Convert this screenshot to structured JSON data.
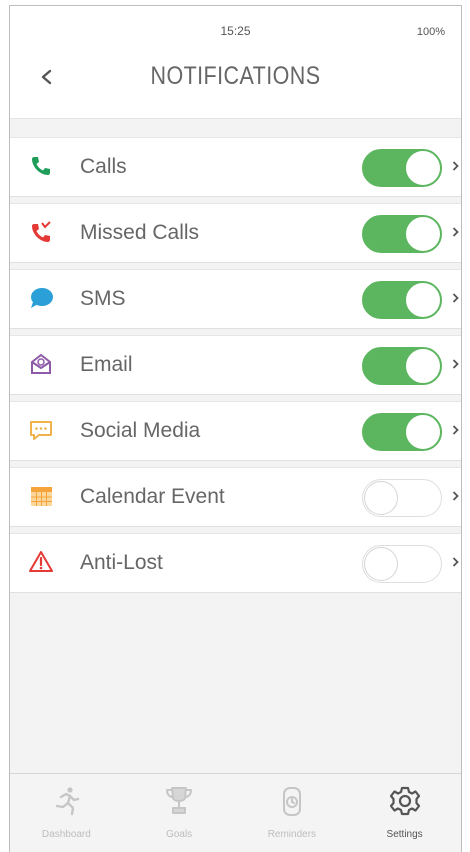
{
  "status": {
    "time": "15:25",
    "battery": "100%"
  },
  "header": {
    "title": "NOTIFICATIONS",
    "back_icon": "chevron-left-icon"
  },
  "notifications": [
    {
      "label": "Calls",
      "icon": "phone-icon",
      "color": "#1f9e5a",
      "enabled": true
    },
    {
      "label": "Missed Calls",
      "icon": "missed-call-icon",
      "color": "#e53935",
      "enabled": true
    },
    {
      "label": "SMS",
      "icon": "chat-bubble-icon",
      "color": "#2a9fd8",
      "enabled": true
    },
    {
      "label": "Email",
      "icon": "envelope-icon",
      "color": "#8e5ba8",
      "enabled": true
    },
    {
      "label": "Social Media",
      "icon": "speech-icon",
      "color": "#f0b24a",
      "enabled": true
    },
    {
      "label": "Calendar Event",
      "icon": "calendar-icon",
      "color": "#f4a43a",
      "enabled": false
    },
    {
      "label": "Anti-Lost",
      "icon": "warning-icon",
      "color": "#e53935",
      "enabled": false
    }
  ],
  "toggle_on_color": "#5cb65f",
  "tabs": [
    {
      "label": "Dashboard",
      "icon": "running-man-icon",
      "active": false
    },
    {
      "label": "Goals",
      "icon": "trophy-icon",
      "active": false
    },
    {
      "label": "Reminders",
      "icon": "alarm-clock-icon",
      "active": false
    },
    {
      "label": "Settings",
      "icon": "gear-icon",
      "active": true
    }
  ]
}
